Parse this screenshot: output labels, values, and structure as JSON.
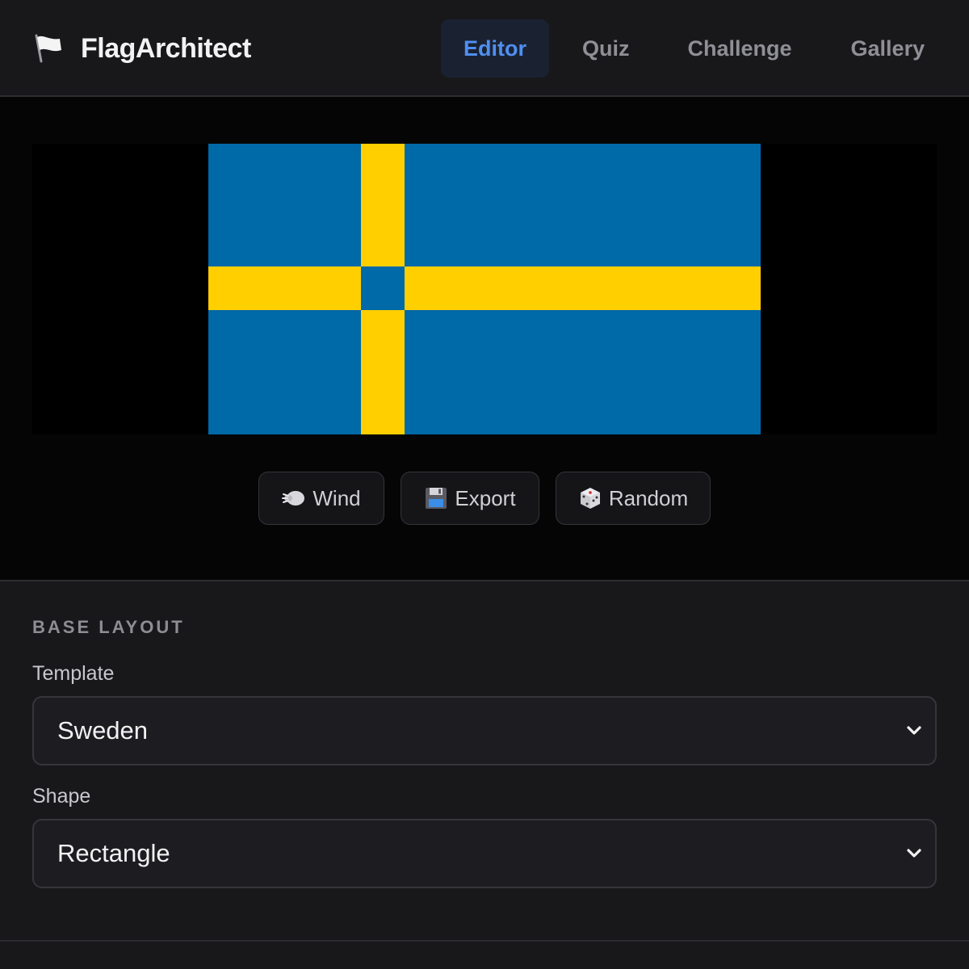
{
  "app": {
    "name": "FlagArchitect",
    "logo_icon": "white-flag-icon"
  },
  "nav": {
    "tabs": [
      {
        "label": "Editor",
        "active": true
      },
      {
        "label": "Quiz",
        "active": false
      },
      {
        "label": "Challenge",
        "active": false
      },
      {
        "label": "Gallery",
        "active": false
      }
    ]
  },
  "flag": {
    "template": "Sweden",
    "field_color": "#0069a8",
    "cross_color": "#ffcf00"
  },
  "actions": [
    {
      "label": "Wind",
      "icon": "wind-face-icon"
    },
    {
      "label": "Export",
      "icon": "floppy-disk-icon"
    },
    {
      "label": "Random",
      "icon": "dice-icon"
    }
  ],
  "base_layout": {
    "section_title": "BASE LAYOUT",
    "template_label": "Template",
    "template_value": "Sweden",
    "shape_label": "Shape",
    "shape_value": "Rectangle"
  },
  "colors": {
    "accent": "#4f8ff0",
    "active_tab_bg": "#1a2232",
    "background": "#18181b",
    "stage_background": "#050505"
  }
}
